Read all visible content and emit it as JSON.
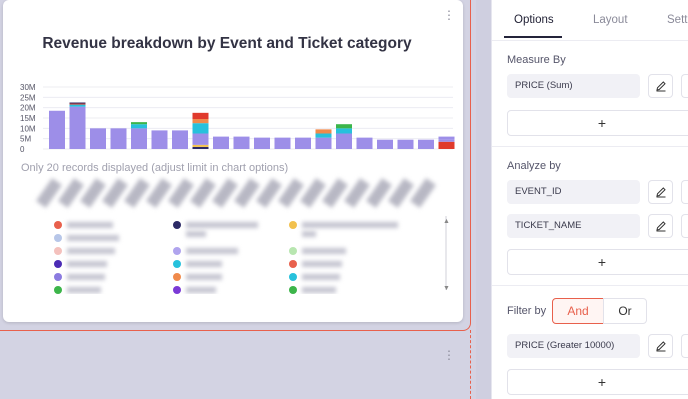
{
  "chart": {
    "title": "Revenue breakdown by Event and Ticket category",
    "note": "Only 20 records displayed (adjust limit in chart options)"
  },
  "panel": {
    "tabs": [
      "Options",
      "Layout",
      "Setti"
    ],
    "measure_label": "Measure By",
    "measure_field": "PRICE (Sum)",
    "analyze_label": "Analyze by",
    "analyze_fields": [
      "EVENT_ID",
      "TICKET_NAME"
    ],
    "filter_label": "Filter by",
    "filter_and": "And",
    "filter_or": "Or",
    "filter_field": "PRICE (Greater 10000)",
    "add_symbol": "+"
  },
  "icons": {
    "edit": "pencil-icon",
    "menu": "kebab-icon"
  },
  "colors": {
    "accent": "#e8604c",
    "bar_main": "#9d8ee8",
    "bar_cyan": "#27c1dc",
    "bar_red": "#e03a2c",
    "bar_orange": "#f08a4b",
    "bar_green": "#3cb54a",
    "bar_navy": "#2c2a66",
    "bar_yellow": "#f2c14e"
  },
  "chart_data": {
    "type": "bar",
    "stacked": true,
    "y_ticks": [
      "30M",
      "25M",
      "20M",
      "15M",
      "10M",
      "5M",
      "0"
    ],
    "ylim": [
      0,
      30
    ],
    "categories_count": 20,
    "series_totals": [
      18.5,
      22.5,
      10,
      10,
      13,
      9,
      9,
      19.5,
      6,
      6,
      5.5,
      5.5,
      5.5,
      9.5,
      12,
      5.5,
      4.5,
      4.5,
      4.5,
      6
    ]
  }
}
